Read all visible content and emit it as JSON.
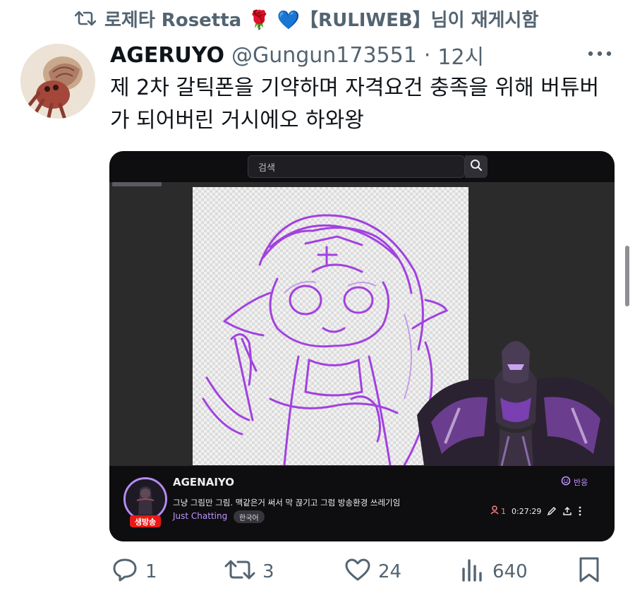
{
  "repost": {
    "text": "로제타 Rosetta 🌹 💙【RULIWEB】님이 재게시함",
    "icon": "repost-icon"
  },
  "tweet": {
    "display_name": "AGERUYO",
    "handle": "@Gungun173551",
    "separator": "·",
    "time": "12시",
    "text": "제 2차 갈틱폰을 기약하며 자격요건 충족을 위해 버튜버가 되어버린 거시에오 하와왕",
    "more_icon": "more-dots-icon"
  },
  "media": {
    "search_placeholder": "검색",
    "channel": {
      "name": "AGENAIYO",
      "title": "그냥 그림만 그림. 맥같은거 써서 막 끊기고 그럼 방송환경 쓰레기임",
      "category": "Just Chatting",
      "tag": "한국어",
      "live_badge": "생방송",
      "react_label": "반응",
      "viewers": "1",
      "uptime": "0:27:29"
    },
    "colors": {
      "accent": "#bf94ff",
      "live": "#e91916",
      "sketch": "#9b30e0"
    }
  },
  "actions": {
    "replies": "1",
    "reposts": "3",
    "likes": "24",
    "views": "640"
  }
}
